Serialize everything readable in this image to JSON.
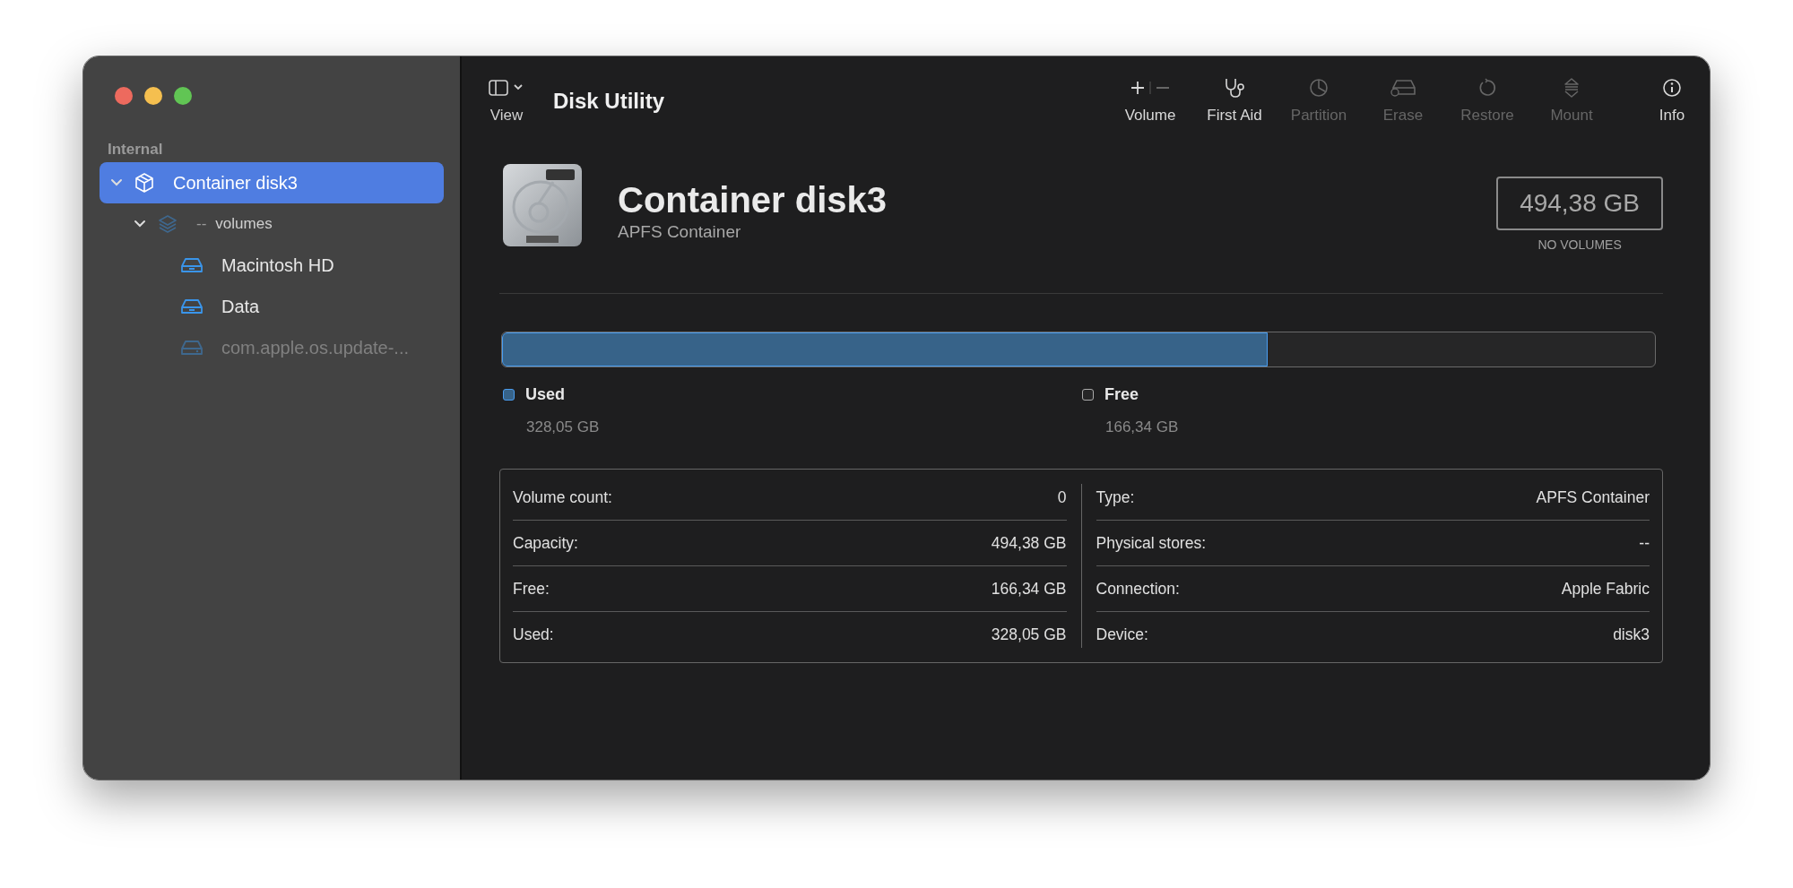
{
  "window": {
    "title": "Disk Utility"
  },
  "sidebar": {
    "section": "Internal",
    "items": [
      {
        "kind": "container",
        "label": "Container disk3",
        "selected": true,
        "expanded": true,
        "children": [
          {
            "kind": "group",
            "prefix": "--",
            "label": "volumes",
            "selected": false,
            "expanded": true,
            "children": [
              {
                "kind": "volume",
                "label": "Macintosh HD",
                "selected": false,
                "mounted": true
              },
              {
                "kind": "volume",
                "label": "Data",
                "selected": false,
                "mounted": true
              },
              {
                "kind": "volume",
                "label": "com.apple.os.update-...",
                "selected": false,
                "mounted": false
              }
            ]
          }
        ]
      }
    ]
  },
  "toolbar": {
    "view": {
      "label": "View"
    },
    "buttons": [
      {
        "kind": "volume",
        "label": "Volume",
        "disabled": false
      },
      {
        "kind": "first-aid",
        "label": "First Aid",
        "disabled": false
      },
      {
        "kind": "partition",
        "label": "Partition",
        "disabled": true
      },
      {
        "kind": "erase",
        "label": "Erase",
        "disabled": true
      },
      {
        "kind": "restore",
        "label": "Restore",
        "disabled": true
      },
      {
        "kind": "mount",
        "label": "Mount",
        "disabled": true
      },
      {
        "kind": "info",
        "label": "Info",
        "disabled": false
      }
    ]
  },
  "header": {
    "title": "Container disk3",
    "subtitle": "APFS Container",
    "size": "494,38 GB",
    "size_caption": "NO VOLUMES"
  },
  "usage": {
    "level": 0.664,
    "legend": [
      {
        "kind": "used",
        "label": "Used",
        "value": "328,05 GB"
      },
      {
        "kind": "free",
        "label": "Free",
        "value": "166,34 GB"
      }
    ]
  },
  "details": {
    "left": [
      {
        "label": "Volume count:",
        "value": "0"
      },
      {
        "label": "Capacity:",
        "value": "494,38 GB"
      },
      {
        "label": "Free:",
        "value": "166,34 GB"
      },
      {
        "label": "Used:",
        "value": "328,05 GB"
      }
    ],
    "right": [
      {
        "label": "Type:",
        "value": "APFS Container"
      },
      {
        "label": "Physical stores:",
        "value": "--"
      },
      {
        "label": "Connection:",
        "value": "Apple Fabric"
      },
      {
        "label": "Device:",
        "value": "disk3"
      }
    ]
  }
}
